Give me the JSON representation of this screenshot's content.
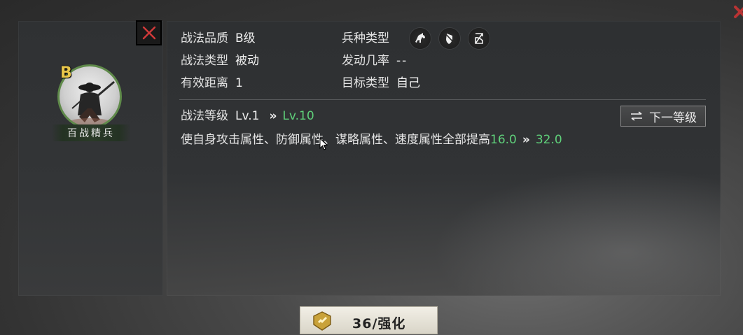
{
  "skill": {
    "grade_letter": "B",
    "name": "百战精兵"
  },
  "info": {
    "quality_label": "战法品质",
    "quality_value": "B级",
    "type_label": "战法类型",
    "type_value": "被动",
    "range_label": "有效距离",
    "range_value": "1",
    "troop_label": "兵种类型",
    "troop_icons": [
      "cavalry-icon",
      "shield-icon",
      "bow-icon"
    ],
    "rate_label": "发动几率",
    "rate_value": "--",
    "target_label": "目标类型",
    "target_value": "自己"
  },
  "level": {
    "label": "战法等级",
    "current": "Lv.1",
    "arrow": "»",
    "max": "Lv.10",
    "next_button_label": "下一等级"
  },
  "description": {
    "text": "使自身攻击属性、防御属性、谋略属性、速度属性全部提高",
    "value_from": "16.0",
    "arrow": "»",
    "value_to": "32.0"
  },
  "enhance": {
    "label": "36/强化"
  },
  "colors": {
    "highlight_green": "#5fd07a",
    "grade_gold": "#e8c64a",
    "close_red": "#d23a3a"
  }
}
